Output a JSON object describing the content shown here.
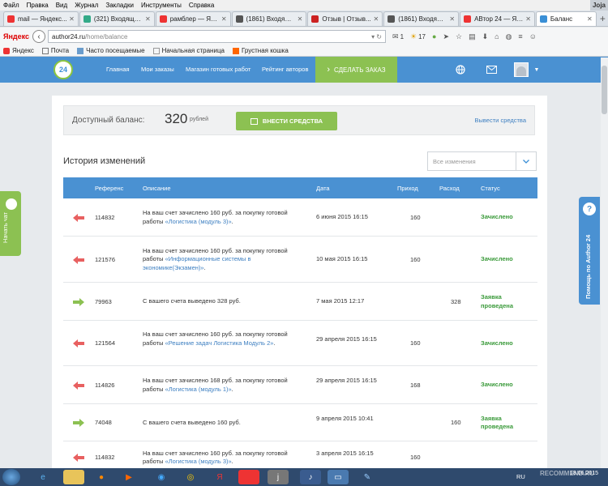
{
  "menubar": {
    "items": [
      "Файл",
      "Правка",
      "Вид",
      "Журнал",
      "Закладки",
      "Инструменты",
      "Справка"
    ],
    "user": "Joja"
  },
  "tabs": [
    {
      "title": "mail — Яндекс...",
      "favicon_color": "#e33"
    },
    {
      "title": "(321) Входящие...",
      "favicon_color": "#3a8"
    },
    {
      "title": "рамблер — Ян...",
      "favicon_color": "#e33"
    },
    {
      "title": "(1861) Входящи...",
      "favicon_color": "#555"
    },
    {
      "title": "Отзыв | Отзыв...",
      "favicon_color": "#c22"
    },
    {
      "title": "(1861) Входящи...",
      "favicon_color": "#555"
    },
    {
      "title": "АВтор 24 — Ян...",
      "favicon_color": "#e33"
    },
    {
      "title": "Баланс",
      "favicon_color": "#3a8fd6",
      "active": true
    }
  ],
  "navbar": {
    "logo": "Яндекс",
    "url_host": "author24.ru",
    "url_path": "/home/balance",
    "mail_count": "1",
    "weather": "17"
  },
  "bookmarks": [
    "Яндекс",
    "Почта",
    "Часто посещаемые",
    "Начальная страница",
    "Грустная кошка"
  ],
  "site_header": {
    "logo": "24",
    "nav": [
      "Главная",
      "Мои заказы",
      "Магазин готовых работ",
      "Рейтинг авторов"
    ],
    "order_button": "СДЕЛАТЬ ЗАКАЗ",
    "order_chevron": "›"
  },
  "balance": {
    "label": "Доступный баланс:",
    "amount": "320",
    "currency": "рублей",
    "deposit_button": "ВНЕСТИ СРЕДСТВА",
    "withdraw_link": "Вывести средства"
  },
  "history": {
    "title": "История изменений",
    "filter_placeholder": "Все изменения",
    "columns": {
      "ref": "Референс",
      "desc": "Описание",
      "date": "Дата",
      "income": "Приход",
      "expense": "Расход",
      "status": "Статус"
    },
    "rows": [
      {
        "dir": "in",
        "ref": "114832",
        "desc_pre": "На ваш счет зачислено 160 руб. за покупку готовой работы ",
        "desc_link": "«Логистика (модуль 3)»",
        "desc_post": ".",
        "date": "6 июня 2015 16:15",
        "income": "160",
        "expense": "",
        "status": "Зачислено"
      },
      {
        "dir": "in",
        "ref": "121576",
        "desc_pre": "На ваш счет зачислено 160 руб. за покупку готовой работы ",
        "desc_link": "«Информационные системы в экономике(Экзамен)»",
        "desc_post": ".",
        "date": "10 мая 2015 16:15",
        "income": "160",
        "expense": "",
        "status": "Зачислено"
      },
      {
        "dir": "out",
        "ref": "79963",
        "desc_pre": "С вашего счета выведено 328 руб.",
        "desc_link": "",
        "desc_post": "",
        "date": "7 мая 2015 12:17",
        "income": "",
        "expense": "328",
        "status": "Заявка проведена"
      },
      {
        "dir": "in",
        "ref": "121564",
        "desc_pre": "На ваш счет зачислено 160 руб. за покупку готовой работы ",
        "desc_link": "«Решение задач Логистика Модуль 2»",
        "desc_post": ".",
        "date": "29 апреля 2015 16:15",
        "income": "160",
        "expense": "",
        "status": "Зачислено"
      },
      {
        "dir": "in",
        "ref": "114826",
        "desc_pre": "На ваш счет зачислено 168 руб. за покупку готовой работы ",
        "desc_link": "«Логистика (модуль 1)»",
        "desc_post": ".",
        "date": "29 апреля 2015 16:15",
        "income": "168",
        "expense": "",
        "status": "Зачислено"
      },
      {
        "dir": "out",
        "ref": "74048",
        "desc_pre": "С вашего счета выведено 160 руб.",
        "desc_link": "",
        "desc_post": "",
        "date": "9 апреля 2015 10:41",
        "income": "",
        "expense": "160",
        "status": "Заявка проведена"
      },
      {
        "dir": "in",
        "ref": "114832",
        "desc_pre": "На ваш счет зачислено 160 руб. за покупку готовой работы ",
        "desc_link": "«Логистика (модуль 3)»",
        "desc_post": ".",
        "date": "3 апреля 2015 16:15",
        "income": "160",
        "expense": "",
        "status": ""
      }
    ]
  },
  "chat_tab": {
    "label": "Начать чат"
  },
  "help_tab": {
    "label": "Помощь по Author 24",
    "icon": "?"
  },
  "taskbar": {
    "lang": "RU",
    "date": "18.06.2015"
  },
  "watermark": "RECOMMEND.RU",
  "colors": {
    "header": "#4a91d2",
    "green": "#8cc152",
    "link": "#3d7fc1",
    "status_green": "#3a9a3a",
    "arrow_in": "#e86060",
    "arrow_out": "#8cc152"
  }
}
